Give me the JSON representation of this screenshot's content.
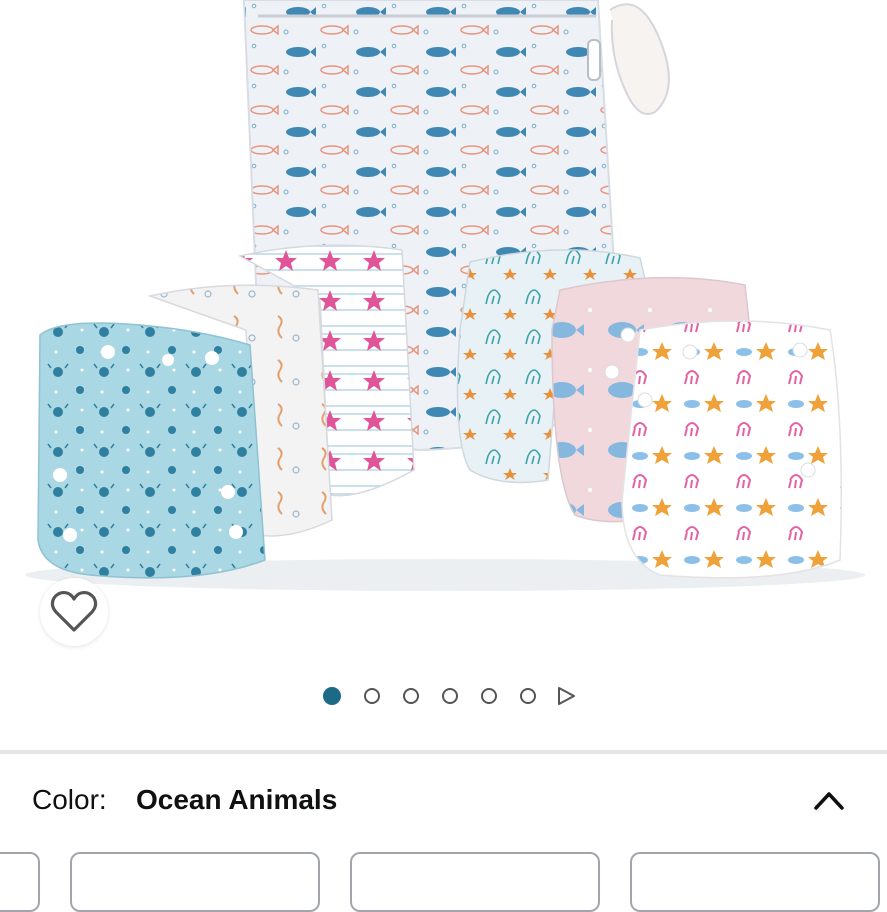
{
  "product": {
    "image_alt": "Cloth diapers in ocean animal prints with a fish-print wet bag"
  },
  "wishlist": {
    "icon": "heart-outline-icon"
  },
  "carousel": {
    "dots": [
      {
        "active": true
      },
      {
        "active": false
      },
      {
        "active": false
      },
      {
        "active": false
      },
      {
        "active": false
      },
      {
        "active": false
      }
    ],
    "play_icon": "play-triangle-icon"
  },
  "variation": {
    "label": "Color:",
    "value": "Ocean Animals",
    "toggle_icon": "chevron-up-icon"
  },
  "colors": {
    "accent": "#1d6a86",
    "text": "#0f1111",
    "divider": "#e3e6e6"
  }
}
